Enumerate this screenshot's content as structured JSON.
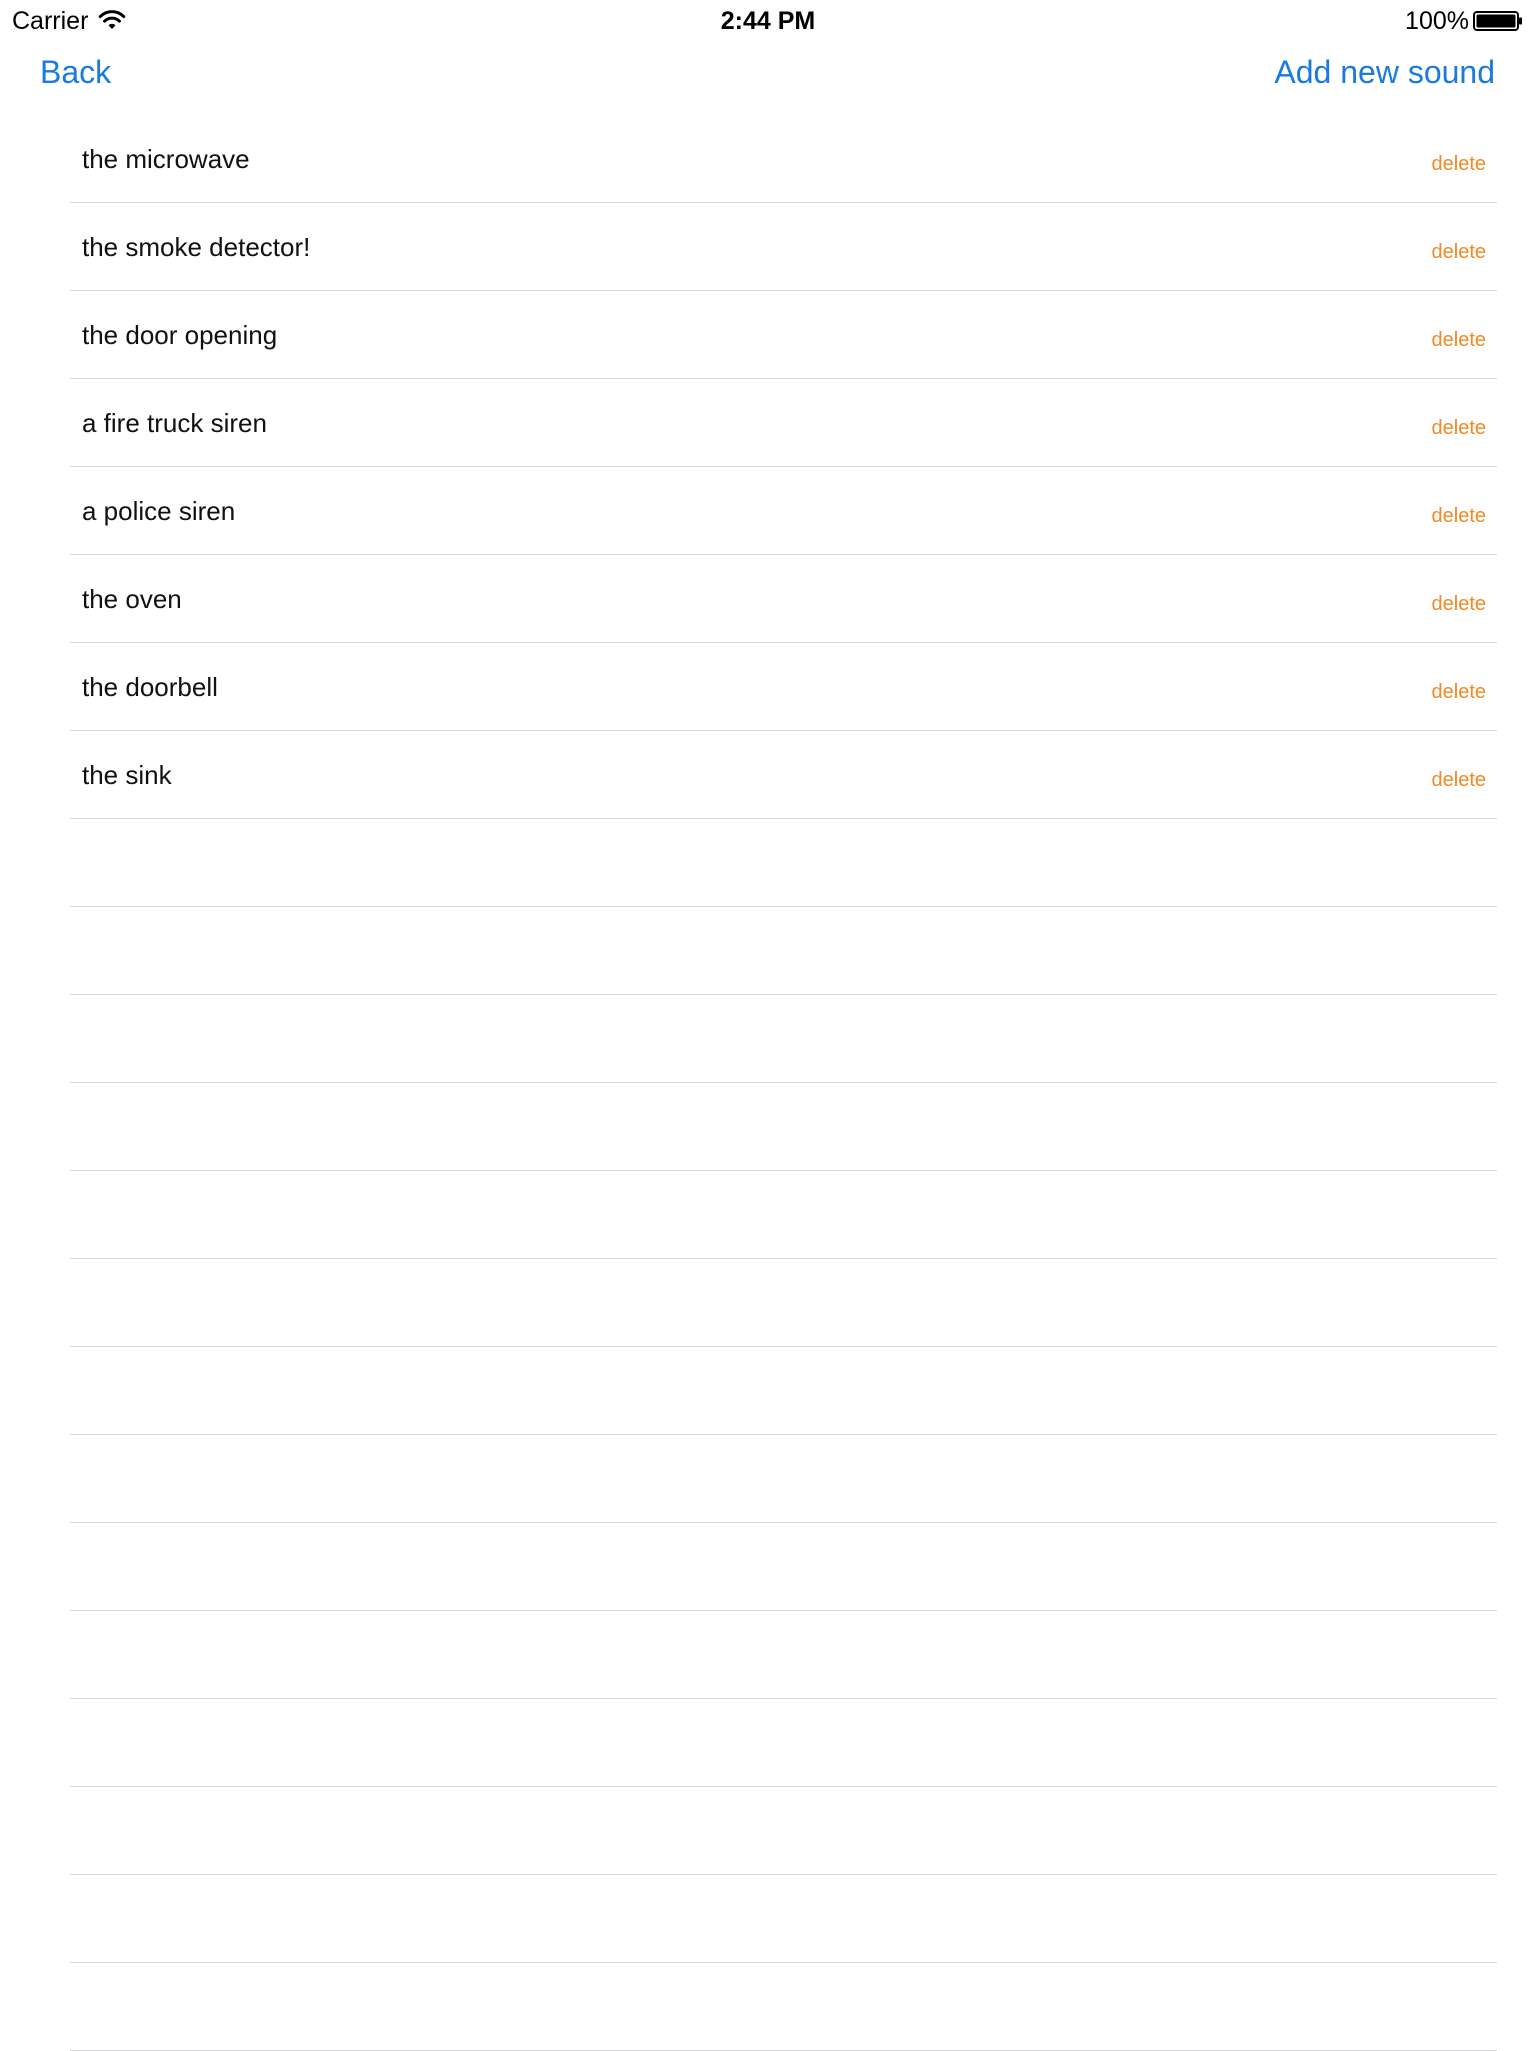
{
  "status_bar": {
    "carrier": "Carrier",
    "time": "2:44 PM",
    "battery": "100%",
    "wifi_icon": "wifi-icon",
    "battery_icon": "battery-full-icon",
    "battery_level": 1.0
  },
  "nav": {
    "back_label": "Back",
    "add_label": "Add new sound",
    "accent_color": "#1a7ae0"
  },
  "sounds": [
    {
      "label": "the microwave",
      "action": "delete"
    },
    {
      "label": "the smoke detector!",
      "action": "delete"
    },
    {
      "label": "the door opening",
      "action": "delete"
    },
    {
      "label": "a fire truck siren",
      "action": "delete"
    },
    {
      "label": "a police siren",
      "action": "delete"
    },
    {
      "label": "the oven",
      "action": "delete"
    },
    {
      "label": "the doorbell",
      "action": "delete"
    },
    {
      "label": "the sink",
      "action": "delete"
    }
  ],
  "colors": {
    "delete": "#f08a24",
    "separator": "#d6d6d8"
  }
}
